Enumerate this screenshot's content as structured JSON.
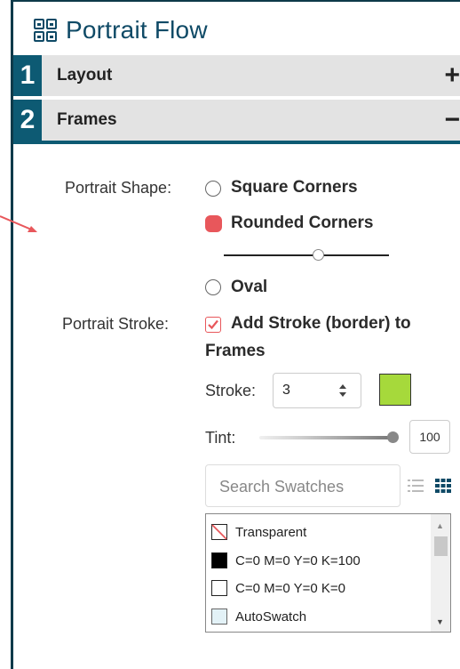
{
  "app": {
    "title": "Portrait Flow"
  },
  "sections": [
    {
      "number": "1",
      "label": "Layout",
      "toggle": "+"
    },
    {
      "number": "2",
      "label": "Frames",
      "toggle": "−"
    }
  ],
  "frames": {
    "shape_label": "Portrait Shape:",
    "shape_options": [
      "Square Corners",
      "Rounded Corners",
      "Oval"
    ],
    "selected_shape": "Rounded Corners",
    "corner_radius_slider_fraction": 0.57,
    "stroke_label": "Portrait Stroke:",
    "stroke_checkbox_line1": "Add Stroke (border) to",
    "stroke_checkbox_line2": "Frames",
    "stroke_checked": true,
    "stroke_field_label": "Stroke:",
    "stroke_value": "3",
    "stroke_color": "#a6d93b",
    "tint_label": "Tint:",
    "tint_value": "100"
  },
  "swatches": {
    "search_placeholder": "Search Swatches",
    "items": [
      {
        "name": "Transparent",
        "color": "none"
      },
      {
        "name": "C=0 M=0 Y=0 K=100",
        "color": "#000000"
      },
      {
        "name": "C=0 M=0 Y=0 K=0",
        "color": "#ffffff"
      },
      {
        "name": "AutoSwatch",
        "color": "#e3f2f7"
      }
    ]
  },
  "colors": {
    "accent": "#0d5a73",
    "title": "#0f4a66",
    "highlight": "#e8575b"
  }
}
